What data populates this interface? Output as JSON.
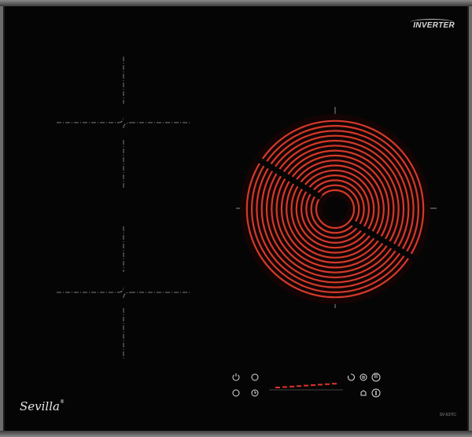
{
  "brand": {
    "logo_text": "Sevilla",
    "logo_reg": "®",
    "badge_text": "INVERTER",
    "model_text": "SV-637IC"
  },
  "controls": {
    "power_icon": "power-icon",
    "lock_icon": "lock-icon",
    "timer_icon": "timer-icon",
    "pause_icon": "pause-icon",
    "boost_label": "B",
    "slider_colors": {
      "active": "#e0322b",
      "inactive": "#444444"
    }
  },
  "colors": {
    "glass": "#050505",
    "frame": "#6b6b6b",
    "heating_coil": "#d23a2a",
    "zone_outline": "#8a8a8a"
  }
}
